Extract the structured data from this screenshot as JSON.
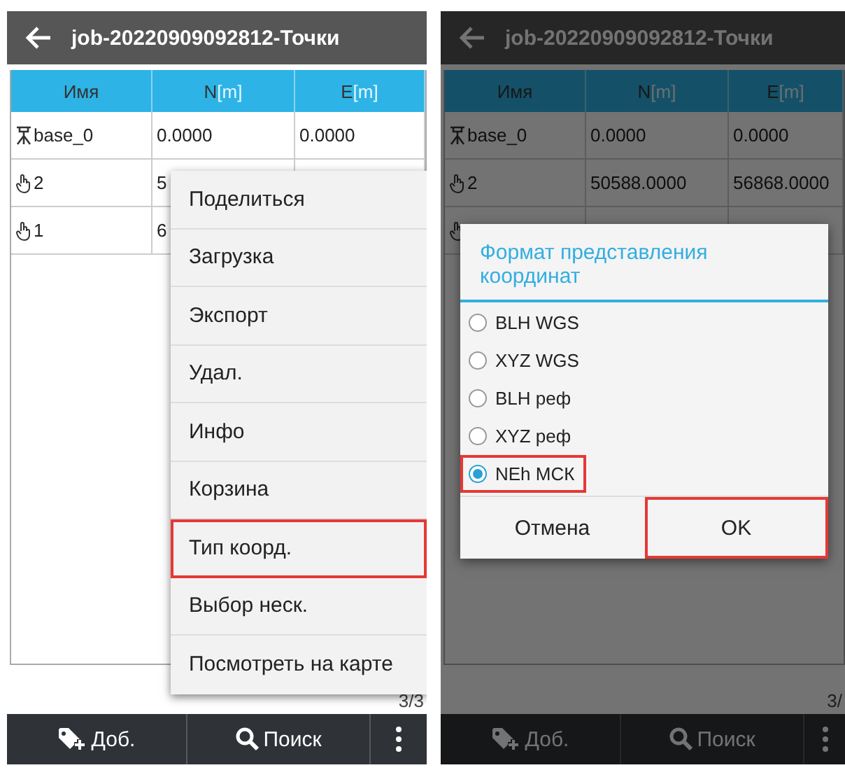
{
  "screens": [
    {
      "title": "job-20220909092812-Точки",
      "dimmed": false,
      "columns": [
        {
          "label": "Имя"
        },
        {
          "label": "N",
          "unit": "[m]"
        },
        {
          "label": "E",
          "unit": "[m]"
        }
      ],
      "rows": [
        {
          "kind": "base",
          "name": "base_0",
          "n": "0.0000",
          "e": "0.0000"
        },
        {
          "kind": "hand",
          "name": "2",
          "n": "5"
        },
        {
          "kind": "hand",
          "name": "1",
          "n": "6"
        }
      ],
      "counter": "3/3",
      "actions": [
        {
          "kind": "add",
          "label": "Доб."
        },
        {
          "kind": "search",
          "label": "Поиск"
        },
        {
          "kind": "more"
        }
      ],
      "menu": {
        "items": [
          {
            "label": "Поделиться",
            "highlighted": false
          },
          {
            "label": "Загрузка",
            "highlighted": false
          },
          {
            "label": "Экспорт",
            "highlighted": false
          },
          {
            "label": "Удал.",
            "highlighted": false
          },
          {
            "label": "Инфо",
            "highlighted": false
          },
          {
            "label": "Корзина",
            "highlighted": false
          },
          {
            "label": "Тип коорд.",
            "highlighted": true
          },
          {
            "label": "Выбор неск.",
            "highlighted": false
          },
          {
            "label": "Посмотреть на карте",
            "highlighted": false
          }
        ]
      }
    },
    {
      "title": "job-20220909092812-Точки",
      "dimmed": true,
      "columns": [
        {
          "label": "Имя"
        },
        {
          "label": "N",
          "unit": "[m]"
        },
        {
          "label": "E",
          "unit": "[m]"
        }
      ],
      "rows": [
        {
          "kind": "base",
          "name": "base_0",
          "n": "0.0000",
          "e": "0.0000"
        },
        {
          "kind": "hand",
          "name": "2",
          "n": "50588.0000",
          "e": "56868.0000"
        },
        {
          "kind": "hand"
        }
      ],
      "counter": "3/",
      "actions": [
        {
          "kind": "add",
          "label": "Доб."
        },
        {
          "kind": "search",
          "label": "Поиск"
        },
        {
          "kind": "more"
        }
      ],
      "dialog": {
        "title": "Формат представления координат",
        "options": [
          {
            "label": "BLH WGS",
            "selected": false,
            "highlighted": false
          },
          {
            "label": "XYZ WGS",
            "selected": false,
            "highlighted": false
          },
          {
            "label": "BLH реф",
            "selected": false,
            "highlighted": false
          },
          {
            "label": "XYZ реф",
            "selected": false,
            "highlighted": false
          },
          {
            "label": "NEh МСК",
            "selected": true,
            "highlighted": true
          }
        ],
        "buttons": [
          {
            "label": "Отмена",
            "highlighted": false
          },
          {
            "label": "OK",
            "highlighted": true
          }
        ]
      }
    }
  ]
}
